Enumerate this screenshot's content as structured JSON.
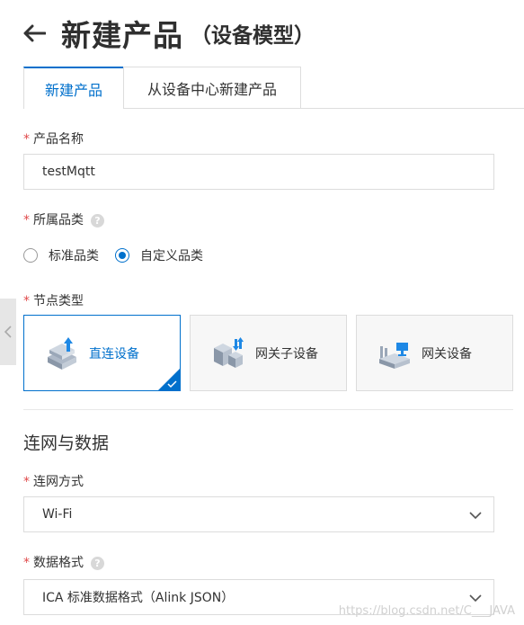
{
  "header": {
    "title": "新建产品",
    "subtitle": "（设备模型）"
  },
  "tabs": [
    {
      "label": "新建产品",
      "active": true
    },
    {
      "label": "从设备中心新建产品",
      "active": false
    }
  ],
  "form": {
    "product_name": {
      "label": "产品名称",
      "value": "testMqtt"
    },
    "category": {
      "label": "所属品类",
      "options": [
        {
          "label": "标准品类",
          "selected": false
        },
        {
          "label": "自定义品类",
          "selected": true
        }
      ]
    },
    "node_type": {
      "label": "节点类型",
      "cards": [
        {
          "label": "直连设备",
          "selected": true
        },
        {
          "label": "网关子设备",
          "selected": false
        },
        {
          "label": "网关设备",
          "selected": false
        }
      ]
    }
  },
  "section": {
    "title": "连网与数据"
  },
  "network": {
    "label": "连网方式",
    "value": "Wi-Fi"
  },
  "data_format": {
    "label": "数据格式",
    "value": "ICA 标准数据格式（Alink JSON）"
  },
  "required_mark": "*",
  "help_symbol": "?",
  "watermark": "https://blog.csdn.net/C___JAVA",
  "colors": {
    "accent": "#0070cc",
    "required": "#e0494a"
  }
}
